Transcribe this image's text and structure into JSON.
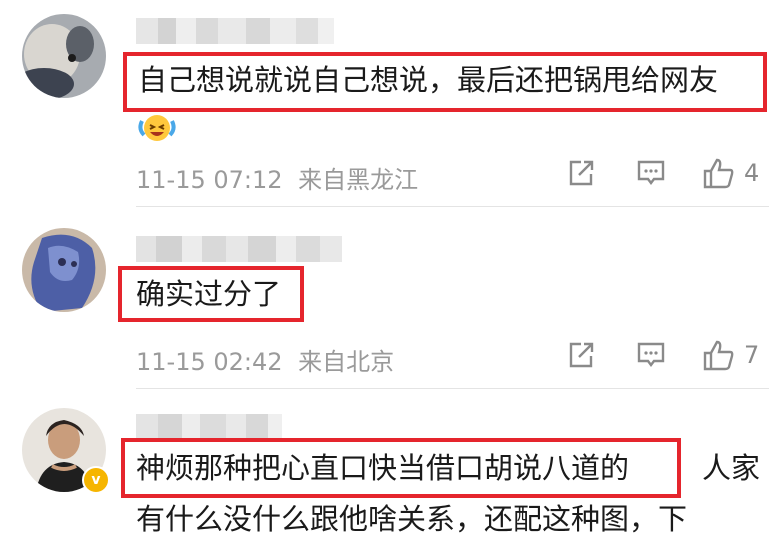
{
  "comments": [
    {
      "text": "自己想说就说自己想说，最后还把锅甩给网友",
      "time": "11-15 07:12",
      "location": "来自黑龙江",
      "likes": "4",
      "emoji": "laughing-crying-emoji"
    },
    {
      "text": "确实过分了",
      "time": "11-15 02:42",
      "location": "来自北京",
      "likes": "7"
    },
    {
      "text_highlight": "神烦那种把心直口快当借口胡说八道的",
      "text_rest": "人家",
      "text_line2": "有什么没什么跟他啥关系，还配这种图，下",
      "badge": "v"
    }
  ],
  "icons": {
    "share": "share-icon",
    "comment": "comment-icon",
    "like": "thumbs-up-icon"
  },
  "colors": {
    "highlight_box": "#e5252d",
    "meta_text": "#9a9a9a",
    "badge": "#f6b500"
  }
}
